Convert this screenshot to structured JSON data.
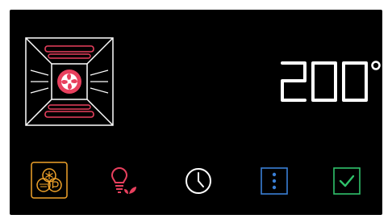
{
  "display": {
    "temperature": "200°"
  },
  "controls": {
    "mode_icon": "oven-fan-heat-icon",
    "buttons": [
      {
        "id": "dual-function",
        "icon": "dual-function-icon"
      },
      {
        "id": "light-eco",
        "icon": "bulb-eco-icon"
      },
      {
        "id": "timer",
        "icon": "clock-icon"
      },
      {
        "id": "menu",
        "icon": "more-vertical-icon"
      },
      {
        "id": "confirm",
        "icon": "check-box-icon"
      }
    ]
  },
  "colors": {
    "background": "#000000",
    "text": "#ffffff",
    "heater": "#e8405e",
    "selected": "#f0a32a",
    "accent_blue": "#3a7fd6",
    "accent_green": "#2fc26b",
    "accent_red": "#e8405e"
  }
}
